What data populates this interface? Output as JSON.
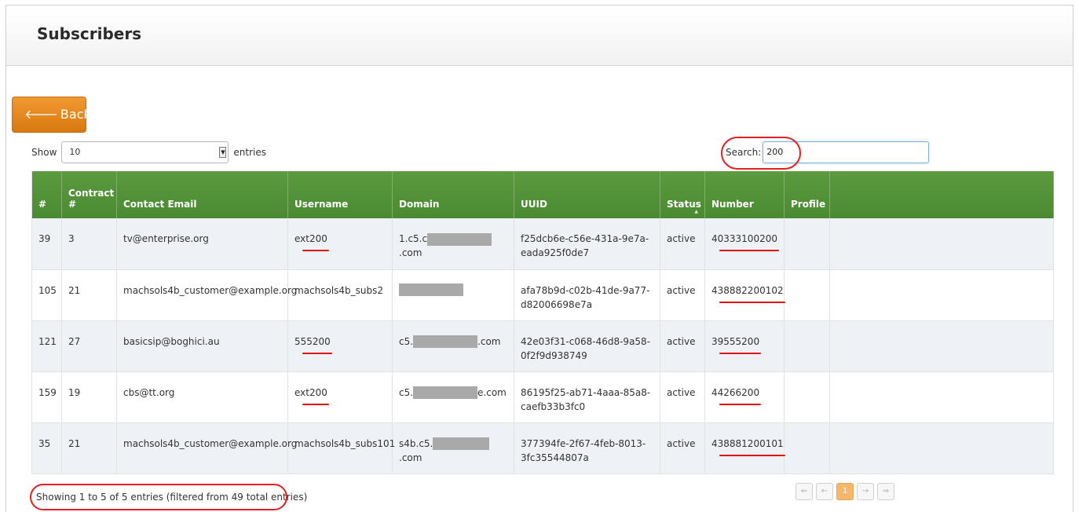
{
  "page": {
    "title": "Subscribers"
  },
  "back_button": {
    "label": "Back",
    "icon": "arrow-left-icon"
  },
  "length_control": {
    "show_label": "Show",
    "selected": "10",
    "entries_label": "entries"
  },
  "search": {
    "label": "Search:",
    "value": "200"
  },
  "table": {
    "columns": [
      "#",
      "Contract #",
      "Contact Email",
      "Username",
      "Domain",
      "UUID",
      "Status",
      "Number",
      "Profile"
    ],
    "rows": [
      {
        "id": "39",
        "contract": "3",
        "email": "tv@enterprise.org",
        "username": "ext200",
        "domain_prefix": "1.c5.c",
        "domain_suffix": ".com",
        "uuid": "f25dcb6e-c56e-431a-9e7a-eada925f0de7",
        "status": "active",
        "number": "40333100200",
        "profile": ""
      },
      {
        "id": "105",
        "contract": "21",
        "email": "machsols4b_customer@example.org",
        "username": "machsols4b_subs2",
        "domain_prefix": "",
        "domain_suffix": "",
        "uuid": "afa78b9d-c02b-41de-9a77-d82006698e7a",
        "status": "active",
        "number": "438882200102",
        "profile": ""
      },
      {
        "id": "121",
        "contract": "27",
        "email": "basicsip@boghici.au",
        "username": "555200",
        "domain_prefix": "c5.",
        "domain_suffix": ".com",
        "uuid": "42e03f31-c068-46d8-9a58-0f2f9d938749",
        "status": "active",
        "number": "39555200",
        "profile": ""
      },
      {
        "id": "159",
        "contract": "19",
        "email": "cbs@tt.org",
        "username": "ext200",
        "domain_prefix": "c5.",
        "domain_suffix": "e.com",
        "uuid": "86195f25-ab71-4aaa-85a8-caefb33b3fc0",
        "status": "active",
        "number": "44266200",
        "profile": ""
      },
      {
        "id": "35",
        "contract": "21",
        "email": "machsols4b_customer@example.org",
        "username": "machsols4b_subs101",
        "domain_prefix": "s4b.c5.",
        "domain_suffix": ".com",
        "uuid": "377394fe-2f67-4feb-8013-3fc35544807a",
        "status": "active",
        "number": "438881200101",
        "profile": ""
      }
    ]
  },
  "info": {
    "text": "Showing 1 to 5 of 5 entries (filtered from 49 total entries)"
  },
  "pagination": {
    "first": "⇐",
    "prev": "←",
    "current": "1",
    "next": "→",
    "last": "⇒"
  },
  "colors": {
    "header_green": "#4a8a32",
    "back_button_orange": "#e8891d",
    "annotation_red": "#e01010"
  }
}
